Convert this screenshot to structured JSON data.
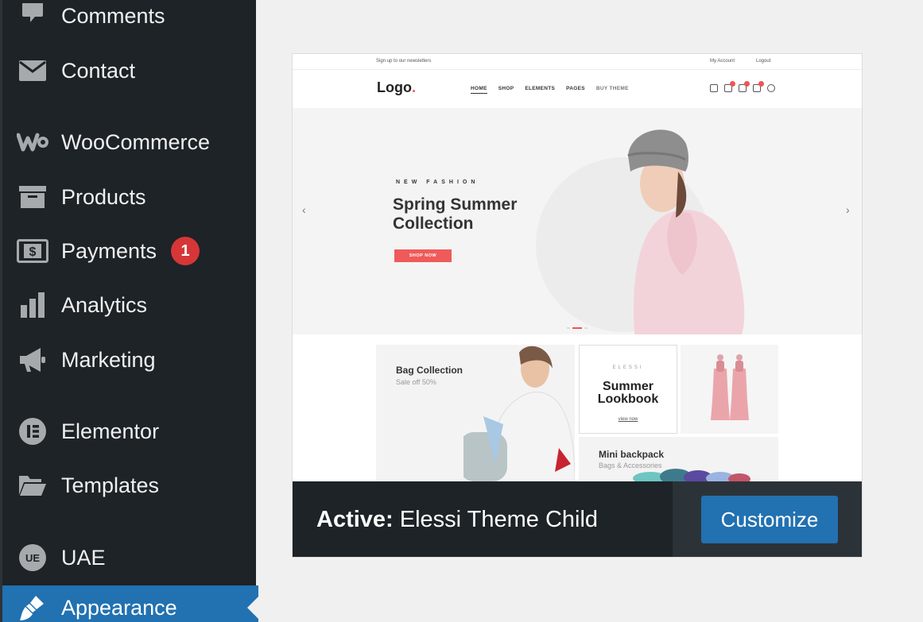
{
  "sidebar": {
    "items": [
      {
        "label": "Comments",
        "icon": "comment-icon"
      },
      {
        "label": "Contact",
        "icon": "envelope-icon"
      },
      {
        "label": "WooCommerce",
        "icon": "woocommerce-icon"
      },
      {
        "label": "Products",
        "icon": "archive-box-icon"
      },
      {
        "label": "Payments",
        "icon": "dollar-icon",
        "badge": "1"
      },
      {
        "label": "Analytics",
        "icon": "bar-chart-icon"
      },
      {
        "label": "Marketing",
        "icon": "megaphone-icon"
      },
      {
        "label": "Elementor",
        "icon": "elementor-icon"
      },
      {
        "label": "Templates",
        "icon": "folder-icon"
      },
      {
        "label": "UAE",
        "icon": "uae-icon"
      },
      {
        "label": "Appearance",
        "icon": "paintbrush-icon",
        "active": true
      }
    ],
    "colors": {
      "background": "#1d2327",
      "active": "#2271b1",
      "badge": "#d63638"
    }
  },
  "theme": {
    "active_prefix": "Active:",
    "name": "Elessi Theme Child",
    "customize_label": "Customize",
    "screenshot": {
      "newsletter": "Sign up to our newsletters",
      "my_account": "My Account",
      "logout": "Logout",
      "logo": "Logo",
      "logo_dot": ".",
      "nav": [
        "HOME",
        "SHOP",
        "ELEMENTS",
        "PAGES",
        "BUY THEME"
      ],
      "hero_kicker": "NEW FASHION",
      "hero_title_line1": "Spring Summer",
      "hero_title_line2": "Collection",
      "hero_button": "SHOP NOW",
      "tile_bag_title": "Bag Collection",
      "tile_bag_sub": "Sale off 50%",
      "tile_look_kicker": "ELESSI",
      "tile_look_title_line1": "Summer",
      "tile_look_title_line2": "Lookbook",
      "tile_look_link": "view now",
      "tile_mini_title": "Mini backpack",
      "tile_mini_sub": "Bags & Accessories"
    }
  }
}
